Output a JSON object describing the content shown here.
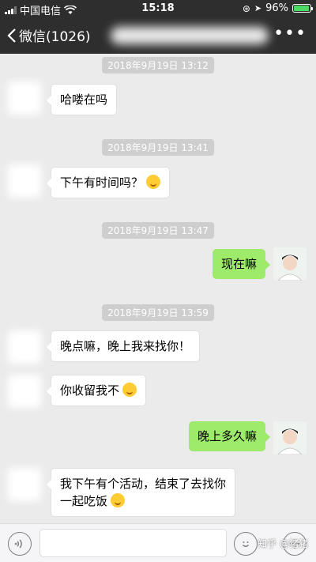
{
  "status_bar": {
    "carrier": "中国电信",
    "time": "15:18",
    "battery": "96%",
    "battery_level": 0.96
  },
  "nav": {
    "back_label": "微信(1026)",
    "more_label": "•••"
  },
  "messages": [
    {
      "timestamp": "2018年9月19日 13:12",
      "from": "other",
      "text": "哈喽在吗"
    },
    {
      "timestamp": "2018年9月19日 13:41",
      "from": "other",
      "text": "下午有时间吗？",
      "emoji": "laughing-crying-emoji"
    },
    {
      "timestamp": "2018年9月19日 13:47",
      "from": "me",
      "text": "现在嘛"
    },
    {
      "timestamp": "2018年9月19日 13:59",
      "from": "other",
      "text": "晚点嘛，晚上我来找你！"
    },
    {
      "from": "other",
      "text": "你收留我不",
      "emoji": "grinning-sweat-emoji"
    },
    {
      "from": "me",
      "text": "晚上多久嘛"
    },
    {
      "from": "other",
      "text_line1": "我下午有个活动，结束了去找你",
      "text_line2": "一起吃饭",
      "emoji": "smiling-emoji"
    }
  ],
  "input_bar": {
    "watermark": "知乎 @猪猪"
  }
}
